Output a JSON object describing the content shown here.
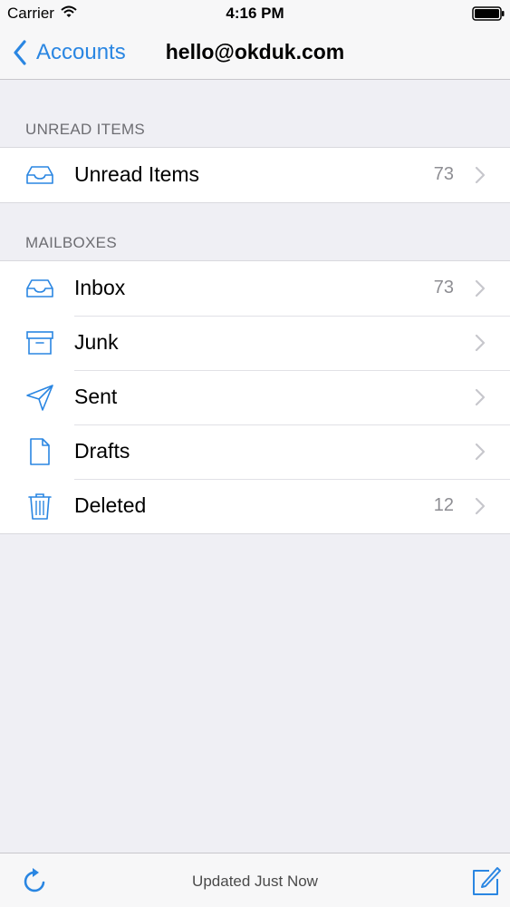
{
  "status_bar": {
    "carrier": "Carrier",
    "time": "4:16 PM",
    "wifi_icon": "wifi-icon",
    "battery_icon": "battery-icon"
  },
  "nav": {
    "back_label": "Accounts",
    "back_icon": "chevron-left-icon",
    "title": "hello@okduk.com"
  },
  "sections": {
    "unread": {
      "header": "UNREAD ITEMS",
      "rows": [
        {
          "label": "Unread Items",
          "count": "73",
          "icon": "inbox-tray-icon"
        }
      ]
    },
    "mailboxes": {
      "header": "MAILBOXES",
      "rows": [
        {
          "label": "Inbox",
          "count": "73",
          "icon": "inbox-tray-icon"
        },
        {
          "label": "Junk",
          "count": "",
          "icon": "archive-box-icon"
        },
        {
          "label": "Sent",
          "count": "",
          "icon": "paper-plane-icon"
        },
        {
          "label": "Drafts",
          "count": "",
          "icon": "document-icon"
        },
        {
          "label": "Deleted",
          "count": "12",
          "icon": "trash-icon"
        }
      ]
    }
  },
  "toolbar": {
    "status": "Updated Just Now",
    "refresh_icon": "refresh-icon",
    "compose_icon": "compose-icon"
  },
  "colors": {
    "accent": "#2a86e2",
    "background": "#efeff4",
    "secondary_text": "#8e8e93",
    "section_header": "#6d6d72"
  }
}
